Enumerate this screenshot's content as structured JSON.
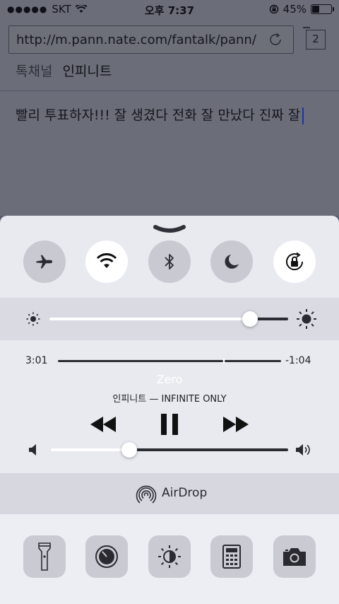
{
  "status_bar": {
    "carrier": "SKT",
    "time": "오후 7:37",
    "battery_percent": "45%",
    "battery_level": 0.45
  },
  "browser": {
    "url": "http://m.pann.nate.com/fantalk/pann/w...",
    "tab_count": "2",
    "breadcrumb_channel": "톡채널",
    "breadcrumb_current": "인피니트",
    "comment_text": "빨리 투표하자!!! 잘 생겼다 전화 잘 만났다 진짜 잘"
  },
  "control_center": {
    "toggles": [
      {
        "name": "airplane-mode",
        "icon": "airplane-icon",
        "on": false
      },
      {
        "name": "wifi",
        "icon": "wifi-icon",
        "on": true
      },
      {
        "name": "bluetooth",
        "icon": "bluetooth-icon",
        "on": false
      },
      {
        "name": "do-not-disturb",
        "icon": "moon-icon",
        "on": false
      },
      {
        "name": "rotation-lock",
        "icon": "rotation-lock-icon",
        "on": true
      }
    ],
    "brightness_level": 0.84,
    "music": {
      "elapsed": "3:01",
      "remaining": "-1:04",
      "progress": 0.74,
      "track_title": "Zero",
      "artist_album": "인피니트 — INFINITE ONLY",
      "volume_level": 0.33
    },
    "airdrop_label": "AirDrop",
    "shortcuts": [
      {
        "name": "flashlight",
        "icon": "flashlight-icon"
      },
      {
        "name": "timer",
        "icon": "timer-icon"
      },
      {
        "name": "night-shift",
        "icon": "night-shift-icon"
      },
      {
        "name": "calculator",
        "icon": "calculator-icon"
      },
      {
        "name": "camera",
        "icon": "camera-icon"
      }
    ]
  }
}
